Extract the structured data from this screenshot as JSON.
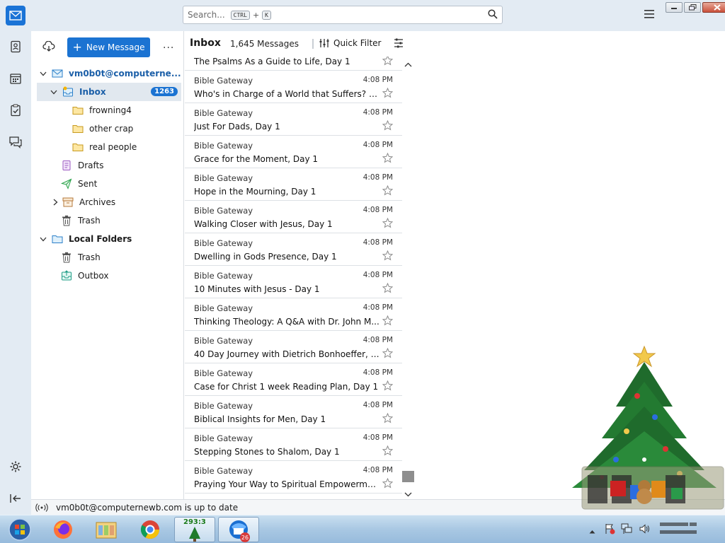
{
  "search": {
    "placeholder": "Search...",
    "shortcut_mod": "CTRL",
    "shortcut_plus": "+",
    "shortcut_key": "K"
  },
  "folder_pane": {
    "new_message_label": "New Message",
    "more_label": "...",
    "account": "vm0b0t@computerne...",
    "inbox": {
      "label": "Inbox",
      "unread": "1263"
    },
    "subfolders": [
      "frowning4",
      "other crap",
      "real people"
    ],
    "drafts": "Drafts",
    "sent": "Sent",
    "archives": "Archives",
    "trash": "Trash",
    "local_folders": "Local Folders",
    "local_trash": "Trash",
    "outbox": "Outbox"
  },
  "thread_pane": {
    "title": "Inbox",
    "count": "1,645 Messages",
    "quick_filter": "Quick Filter",
    "first_partial_subject": "The Psalms As a Guide to Life, Day 1",
    "messages": [
      {
        "sender": "Bible Gateway",
        "time": "4:08 PM",
        "subject": "Who's in Charge of a World that Suffers? D..."
      },
      {
        "sender": "Bible Gateway",
        "time": "4:08 PM",
        "subject": "Just For Dads, Day 1"
      },
      {
        "sender": "Bible Gateway",
        "time": "4:08 PM",
        "subject": "Grace for the Moment, Day 1"
      },
      {
        "sender": "Bible Gateway",
        "time": "4:08 PM",
        "subject": "Hope in the Mourning, Day 1"
      },
      {
        "sender": "Bible Gateway",
        "time": "4:08 PM",
        "subject": "Walking Closer with Jesus, Day 1"
      },
      {
        "sender": "Bible Gateway",
        "time": "4:08 PM",
        "subject": "Dwelling in Gods Presence, Day 1"
      },
      {
        "sender": "Bible Gateway",
        "time": "4:08 PM",
        "subject": "10 Minutes with Jesus - Day 1"
      },
      {
        "sender": "Bible Gateway",
        "time": "4:08 PM",
        "subject": "Thinking Theology: A Q&A with Dr. John M..."
      },
      {
        "sender": "Bible Gateway",
        "time": "4:08 PM",
        "subject": "40 Day Journey with Dietrich Bonhoeffer, D..."
      },
      {
        "sender": "Bible Gateway",
        "time": "4:08 PM",
        "subject": "Case for Christ 1 week Reading Plan, Day 1"
      },
      {
        "sender": "Bible Gateway",
        "time": "4:08 PM",
        "subject": "Biblical Insights for Men, Day 1"
      },
      {
        "sender": "Bible Gateway",
        "time": "4:08 PM",
        "subject": "Stepping Stones to Shalom, Day 1"
      },
      {
        "sender": "Bible Gateway",
        "time": "4:08 PM",
        "subject": "Praying Your Way to Spiritual Empowerme..."
      }
    ]
  },
  "status_bar": {
    "text": "vm0b0t@computernewb.com is up to date"
  },
  "taskbar": {
    "tree_counter": "293:3",
    "thunderbird_badge": "26"
  },
  "colors": {
    "accent": "#1b73d2",
    "chrome": "#e3ebf3",
    "selected": "#e1e8ef"
  }
}
